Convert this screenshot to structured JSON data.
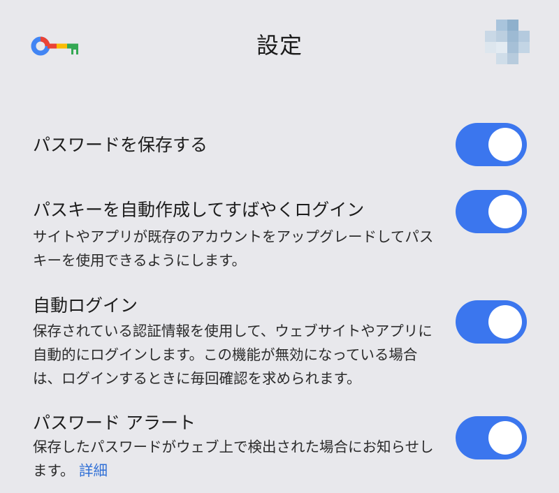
{
  "header": {
    "title": "設定",
    "logo_icon": "key-icon",
    "avatar_icon": "pixelated-avatar"
  },
  "colors": {
    "background": "#e8e8ec",
    "toggle_on": "#3b76ee",
    "link": "#2f6fd6"
  },
  "settings": [
    {
      "title": "パスワードを保存する",
      "enabled": true
    },
    {
      "title": "パスキーを自動作成してすばやくログイン",
      "description": "サイトやアプリが既存のアカウントをアップグレードしてパスキーを使用できるようにします。",
      "enabled": true
    },
    {
      "title": "自動ログイン",
      "description": "保存されている認証情報を使用して、ウェブサイトやアプリに自動的にログインします。この機能が無効になっている場合は、ログインするときに毎回確認を求められます。",
      "enabled": true
    },
    {
      "title": "パスワード アラート",
      "description": "保存したパスワードがウェブ上で検出された場合にお知らせします。",
      "link_label": "詳細",
      "enabled": true
    }
  ]
}
